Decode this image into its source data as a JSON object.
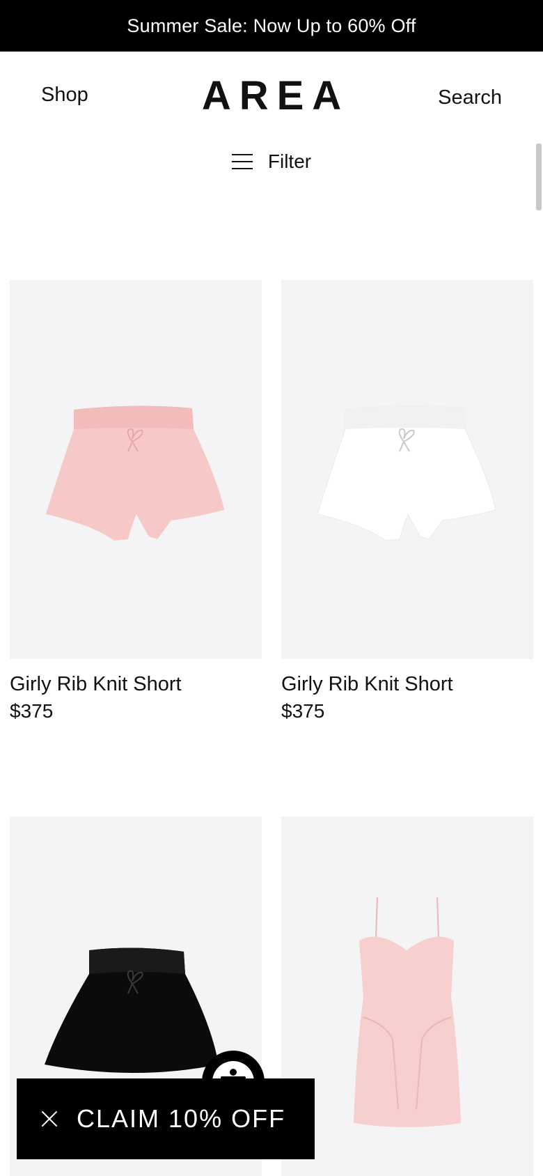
{
  "promo": {
    "text": "Summer Sale: Now Up to 60% Off"
  },
  "header": {
    "shop_label": "Shop",
    "logo": "AREA",
    "search_label": "Search"
  },
  "filter": {
    "label": "Filter"
  },
  "products": [
    {
      "title": "Girly Rib Knit Short",
      "price": "$375",
      "color": "#f6c9c8",
      "kind": "shorts"
    },
    {
      "title": "Girly Rib Knit Short",
      "price": "$375",
      "color": "#f7f7f9",
      "kind": "shorts"
    },
    {
      "title": "",
      "price": "",
      "color": "#0b0b0b",
      "kind": "shorts"
    },
    {
      "title": "",
      "price": "",
      "color": "#f7cfcf",
      "kind": "dress"
    }
  ],
  "popup": {
    "claim_label": "CLAIM 10% OFF"
  },
  "icons": {
    "filter": "hamburger-icon",
    "close": "close-icon",
    "accessibility": "accessibility-icon"
  }
}
